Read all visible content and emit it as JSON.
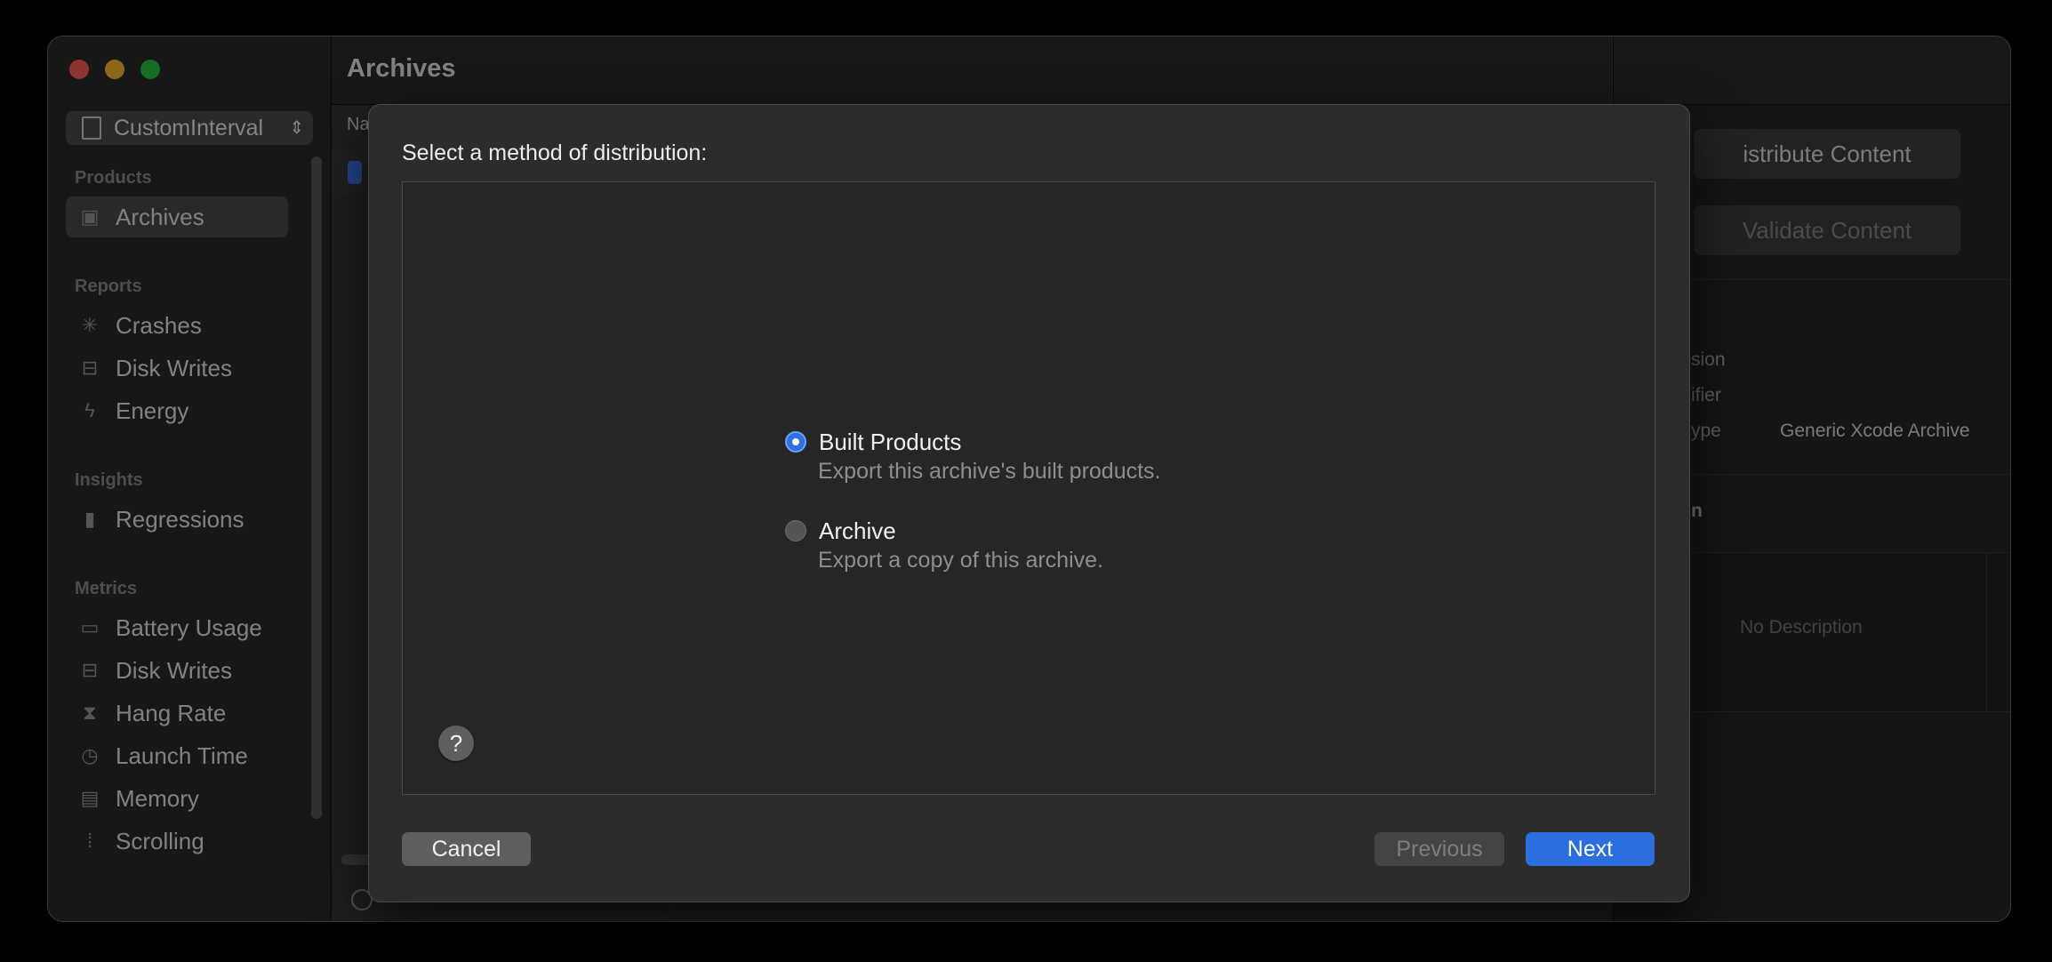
{
  "window": {
    "content_title": "Archives",
    "column_header": "Na"
  },
  "sidebar": {
    "scheme": "CustomInterval",
    "sections": {
      "products": "Products",
      "reports": "Reports",
      "insights": "Insights",
      "metrics": "Metrics"
    },
    "items": {
      "archives": "Archives",
      "crashes": "Crashes",
      "disk_writes_reports": "Disk Writes",
      "energy": "Energy",
      "regressions": "Regressions",
      "battery_usage": "Battery Usage",
      "disk_writes_metrics": "Disk Writes",
      "hang_rate": "Hang Rate",
      "launch_time": "Launch Time",
      "memory": "Memory",
      "scrolling": "Scrolling"
    }
  },
  "inspector": {
    "distribute_button": "istribute Content",
    "validate_button": "Validate Content",
    "version_label": "sion",
    "identifier_label": "ifier",
    "type_label": "ype",
    "type_value": "Generic Xcode Archive",
    "description_section": "n",
    "description_placeholder": "No Description"
  },
  "sheet": {
    "title": "Select a method of distribution:",
    "options": [
      {
        "label": "Built Products",
        "description": "Export this archive's built products.",
        "selected": true
      },
      {
        "label": "Archive",
        "description": "Export a copy of this archive.",
        "selected": false
      }
    ],
    "help": "?",
    "buttons": {
      "cancel": "Cancel",
      "previous": "Previous",
      "next": "Next"
    }
  },
  "colors": {
    "accent": "#2a6ee0",
    "close": "#ff5f57",
    "minimize": "#febc2e",
    "maximize": "#28c840"
  }
}
